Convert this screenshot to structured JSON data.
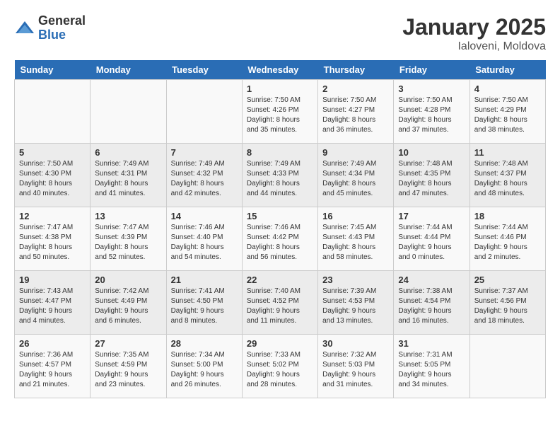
{
  "logo": {
    "general": "General",
    "blue": "Blue"
  },
  "title": "January 2025",
  "location": "Ialoveni, Moldova",
  "days_of_week": [
    "Sunday",
    "Monday",
    "Tuesday",
    "Wednesday",
    "Thursday",
    "Friday",
    "Saturday"
  ],
  "weeks": [
    [
      {
        "day": "",
        "info": ""
      },
      {
        "day": "",
        "info": ""
      },
      {
        "day": "",
        "info": ""
      },
      {
        "day": "1",
        "info": "Sunrise: 7:50 AM\nSunset: 4:26 PM\nDaylight: 8 hours\nand 35 minutes."
      },
      {
        "day": "2",
        "info": "Sunrise: 7:50 AM\nSunset: 4:27 PM\nDaylight: 8 hours\nand 36 minutes."
      },
      {
        "day": "3",
        "info": "Sunrise: 7:50 AM\nSunset: 4:28 PM\nDaylight: 8 hours\nand 37 minutes."
      },
      {
        "day": "4",
        "info": "Sunrise: 7:50 AM\nSunset: 4:29 PM\nDaylight: 8 hours\nand 38 minutes."
      }
    ],
    [
      {
        "day": "5",
        "info": "Sunrise: 7:50 AM\nSunset: 4:30 PM\nDaylight: 8 hours\nand 40 minutes."
      },
      {
        "day": "6",
        "info": "Sunrise: 7:49 AM\nSunset: 4:31 PM\nDaylight: 8 hours\nand 41 minutes."
      },
      {
        "day": "7",
        "info": "Sunrise: 7:49 AM\nSunset: 4:32 PM\nDaylight: 8 hours\nand 42 minutes."
      },
      {
        "day": "8",
        "info": "Sunrise: 7:49 AM\nSunset: 4:33 PM\nDaylight: 8 hours\nand 44 minutes."
      },
      {
        "day": "9",
        "info": "Sunrise: 7:49 AM\nSunset: 4:34 PM\nDaylight: 8 hours\nand 45 minutes."
      },
      {
        "day": "10",
        "info": "Sunrise: 7:48 AM\nSunset: 4:35 PM\nDaylight: 8 hours\nand 47 minutes."
      },
      {
        "day": "11",
        "info": "Sunrise: 7:48 AM\nSunset: 4:37 PM\nDaylight: 8 hours\nand 48 minutes."
      }
    ],
    [
      {
        "day": "12",
        "info": "Sunrise: 7:47 AM\nSunset: 4:38 PM\nDaylight: 8 hours\nand 50 minutes."
      },
      {
        "day": "13",
        "info": "Sunrise: 7:47 AM\nSunset: 4:39 PM\nDaylight: 8 hours\nand 52 minutes."
      },
      {
        "day": "14",
        "info": "Sunrise: 7:46 AM\nSunset: 4:40 PM\nDaylight: 8 hours\nand 54 minutes."
      },
      {
        "day": "15",
        "info": "Sunrise: 7:46 AM\nSunset: 4:42 PM\nDaylight: 8 hours\nand 56 minutes."
      },
      {
        "day": "16",
        "info": "Sunrise: 7:45 AM\nSunset: 4:43 PM\nDaylight: 8 hours\nand 58 minutes."
      },
      {
        "day": "17",
        "info": "Sunrise: 7:44 AM\nSunset: 4:44 PM\nDaylight: 9 hours\nand 0 minutes."
      },
      {
        "day": "18",
        "info": "Sunrise: 7:44 AM\nSunset: 4:46 PM\nDaylight: 9 hours\nand 2 minutes."
      }
    ],
    [
      {
        "day": "19",
        "info": "Sunrise: 7:43 AM\nSunset: 4:47 PM\nDaylight: 9 hours\nand 4 minutes."
      },
      {
        "day": "20",
        "info": "Sunrise: 7:42 AM\nSunset: 4:49 PM\nDaylight: 9 hours\nand 6 minutes."
      },
      {
        "day": "21",
        "info": "Sunrise: 7:41 AM\nSunset: 4:50 PM\nDaylight: 9 hours\nand 8 minutes."
      },
      {
        "day": "22",
        "info": "Sunrise: 7:40 AM\nSunset: 4:52 PM\nDaylight: 9 hours\nand 11 minutes."
      },
      {
        "day": "23",
        "info": "Sunrise: 7:39 AM\nSunset: 4:53 PM\nDaylight: 9 hours\nand 13 minutes."
      },
      {
        "day": "24",
        "info": "Sunrise: 7:38 AM\nSunset: 4:54 PM\nDaylight: 9 hours\nand 16 minutes."
      },
      {
        "day": "25",
        "info": "Sunrise: 7:37 AM\nSunset: 4:56 PM\nDaylight: 9 hours\nand 18 minutes."
      }
    ],
    [
      {
        "day": "26",
        "info": "Sunrise: 7:36 AM\nSunset: 4:57 PM\nDaylight: 9 hours\nand 21 minutes."
      },
      {
        "day": "27",
        "info": "Sunrise: 7:35 AM\nSunset: 4:59 PM\nDaylight: 9 hours\nand 23 minutes."
      },
      {
        "day": "28",
        "info": "Sunrise: 7:34 AM\nSunset: 5:00 PM\nDaylight: 9 hours\nand 26 minutes."
      },
      {
        "day": "29",
        "info": "Sunrise: 7:33 AM\nSunset: 5:02 PM\nDaylight: 9 hours\nand 28 minutes."
      },
      {
        "day": "30",
        "info": "Sunrise: 7:32 AM\nSunset: 5:03 PM\nDaylight: 9 hours\nand 31 minutes."
      },
      {
        "day": "31",
        "info": "Sunrise: 7:31 AM\nSunset: 5:05 PM\nDaylight: 9 hours\nand 34 minutes."
      },
      {
        "day": "",
        "info": ""
      }
    ]
  ]
}
